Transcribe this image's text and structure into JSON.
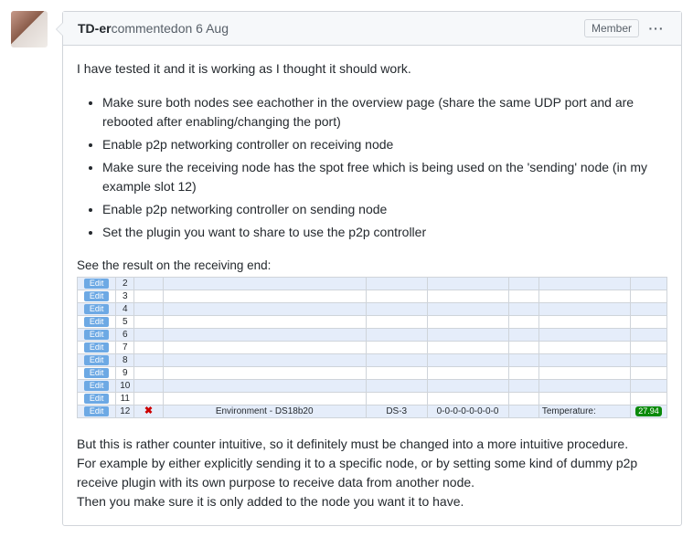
{
  "author": "TD-er",
  "commented": " commented ",
  "timestamp": "on 6 Aug",
  "badge": "Member",
  "intro": "I have tested it and it is working as I thought it should work.",
  "bullets": [
    "Make sure both nodes see eachother in the overview page (share the same UDP port and are rebooted after enabling/changing the port)",
    "Enable p2p networking controller on receiving node",
    "Make sure the receiving node has the spot free which is being used on the 'sending' node (in my example slot 12)",
    "Enable p2p networking controller on sending node",
    "Set the plugin you want to share to use the p2p controller"
  ],
  "see_result": "See the result on the receiving end:",
  "table": {
    "edit_label": "Edit",
    "rows": [
      "2",
      "3",
      "4",
      "5",
      "6",
      "7",
      "8",
      "9",
      "10",
      "11"
    ],
    "last": {
      "num": "12",
      "env": "Environment - DS18b20",
      "ds": "DS-3",
      "addr": "0-0-0-0-0-0-0-0",
      "temp_label": "Temperature:",
      "temp_val": "27.94"
    }
  },
  "outro": [
    "But this is rather counter intuitive, so it definitely must be changed into a more intuitive procedure.",
    "For example by either explicitly sending it to a specific node, or by setting some kind of dummy p2p receive plugin with its own purpose to receive data from another node.",
    "Then you make sure it is only added to the node you want it to have."
  ]
}
